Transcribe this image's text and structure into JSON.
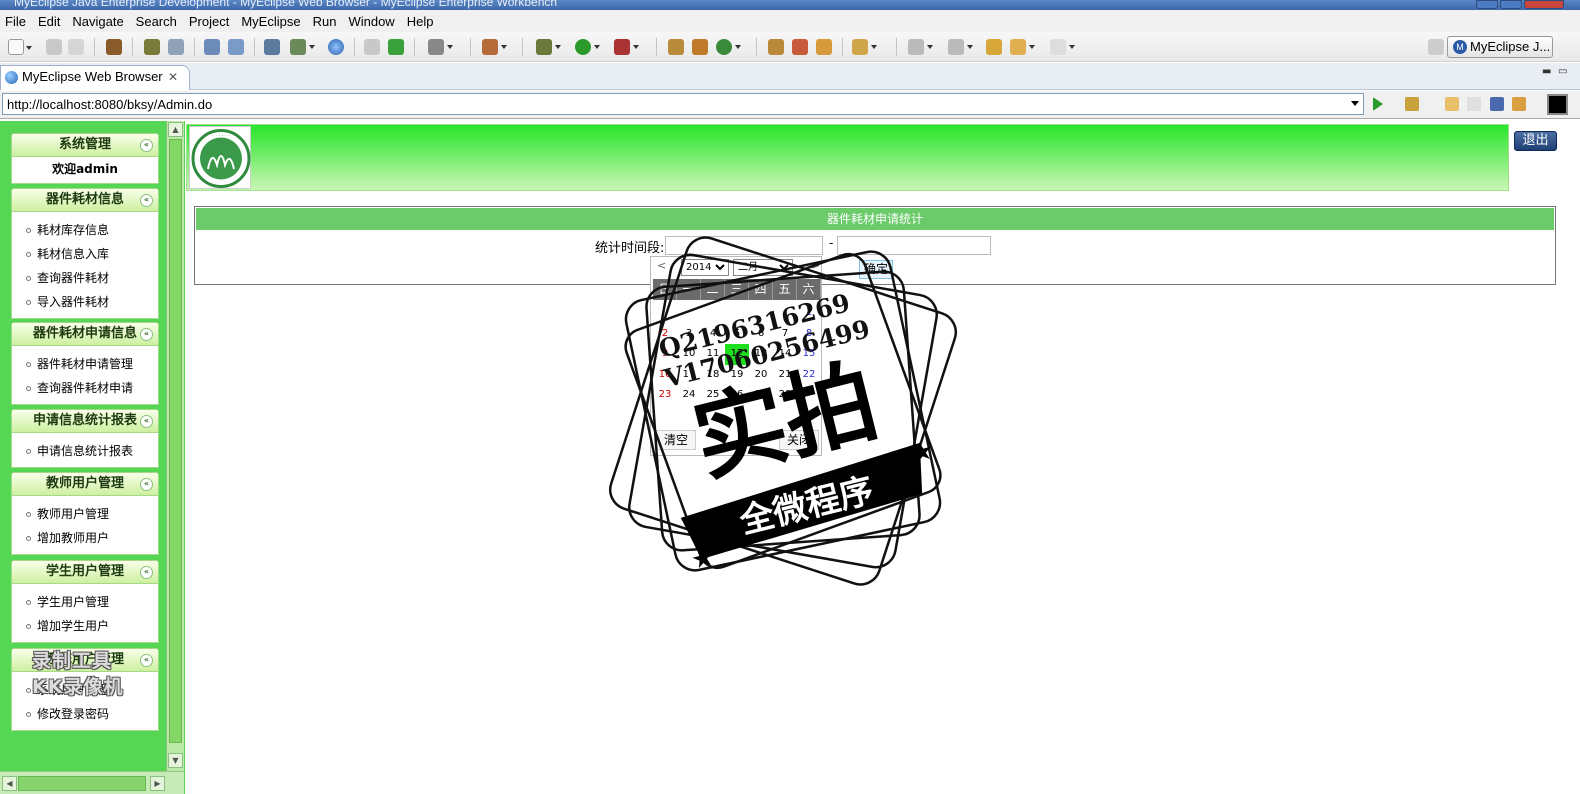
{
  "window": {
    "title": "MyEclipse Java Enterprise Development - MyEclipse Web Browser - MyEclipse Enterprise Workbench"
  },
  "menu": [
    "File",
    "Edit",
    "Navigate",
    "Search",
    "Project",
    "MyEclipse",
    "Run",
    "Window",
    "Help"
  ],
  "perspective": {
    "label": "MyEclipse J..."
  },
  "editor_tab": {
    "label": "MyEclipse Web Browser",
    "close": "✕"
  },
  "address": {
    "url": "http://localhost:8080/bksy/Admin.do"
  },
  "sidebar": {
    "sections": [
      {
        "title": "系统管理",
        "welcome": "欢迎admin",
        "items": []
      },
      {
        "title": "器件耗材信息",
        "items": [
          "耗材库存信息",
          "耗材信息入库",
          "查询器件耗材",
          "导入器件耗材"
        ]
      },
      {
        "title": "器件耗材申请信息",
        "items": [
          "器件耗材申请管理",
          "查询器件耗材申请"
        ]
      },
      {
        "title": "申请信息统计报表",
        "items": [
          "申请信息统计报表"
        ]
      },
      {
        "title": "教师用户管理",
        "items": [
          "教师用户管理",
          "增加教师用户"
        ]
      },
      {
        "title": "学生用户管理",
        "items": [
          "学生用户管理",
          "增加学生用户"
        ]
      },
      {
        "title": "系统用户管理",
        "items": [
          "系统用户管理",
          "修改登录密码"
        ]
      }
    ],
    "fold_glyph": "«"
  },
  "header": {
    "logout_label": "退出"
  },
  "stat_panel": {
    "title": "器件耗材申请统计",
    "range_label": "统计时间段:",
    "separator": "-",
    "confirm_label": "确定"
  },
  "calendar": {
    "prev": "<",
    "next": ">",
    "year": "2014",
    "month": "二月",
    "weekdays": [
      "日",
      "一",
      "二",
      "三",
      "四",
      "五",
      "六"
    ],
    "weeks": [
      [
        "",
        "",
        "",
        "",
        "",
        "",
        "1"
      ],
      [
        "2",
        "3",
        "4",
        "5",
        "6",
        "7",
        "8"
      ],
      [
        "9",
        "10",
        "11",
        "12",
        "13",
        "14",
        "15"
      ],
      [
        "16",
        "17",
        "18",
        "19",
        "20",
        "21",
        "22"
      ],
      [
        "23",
        "24",
        "25",
        "26",
        "27",
        "28",
        ""
      ],
      [
        "",
        "",
        "",
        "",
        "",
        "",
        ""
      ]
    ],
    "today": "12",
    "clear_label": "清空",
    "close_label": "关闭"
  },
  "watermark": {
    "qq": "Q2196316269",
    "v": "V17060256499",
    "big": "实拍",
    "ribbon": "全微程序",
    "corner_line1": "录制工具",
    "corner_line2": "KK录像机"
  },
  "colors": {
    "accent_green": "#28e52a",
    "sidebar_green": "#55d655",
    "today_green": "#1ee01e"
  }
}
